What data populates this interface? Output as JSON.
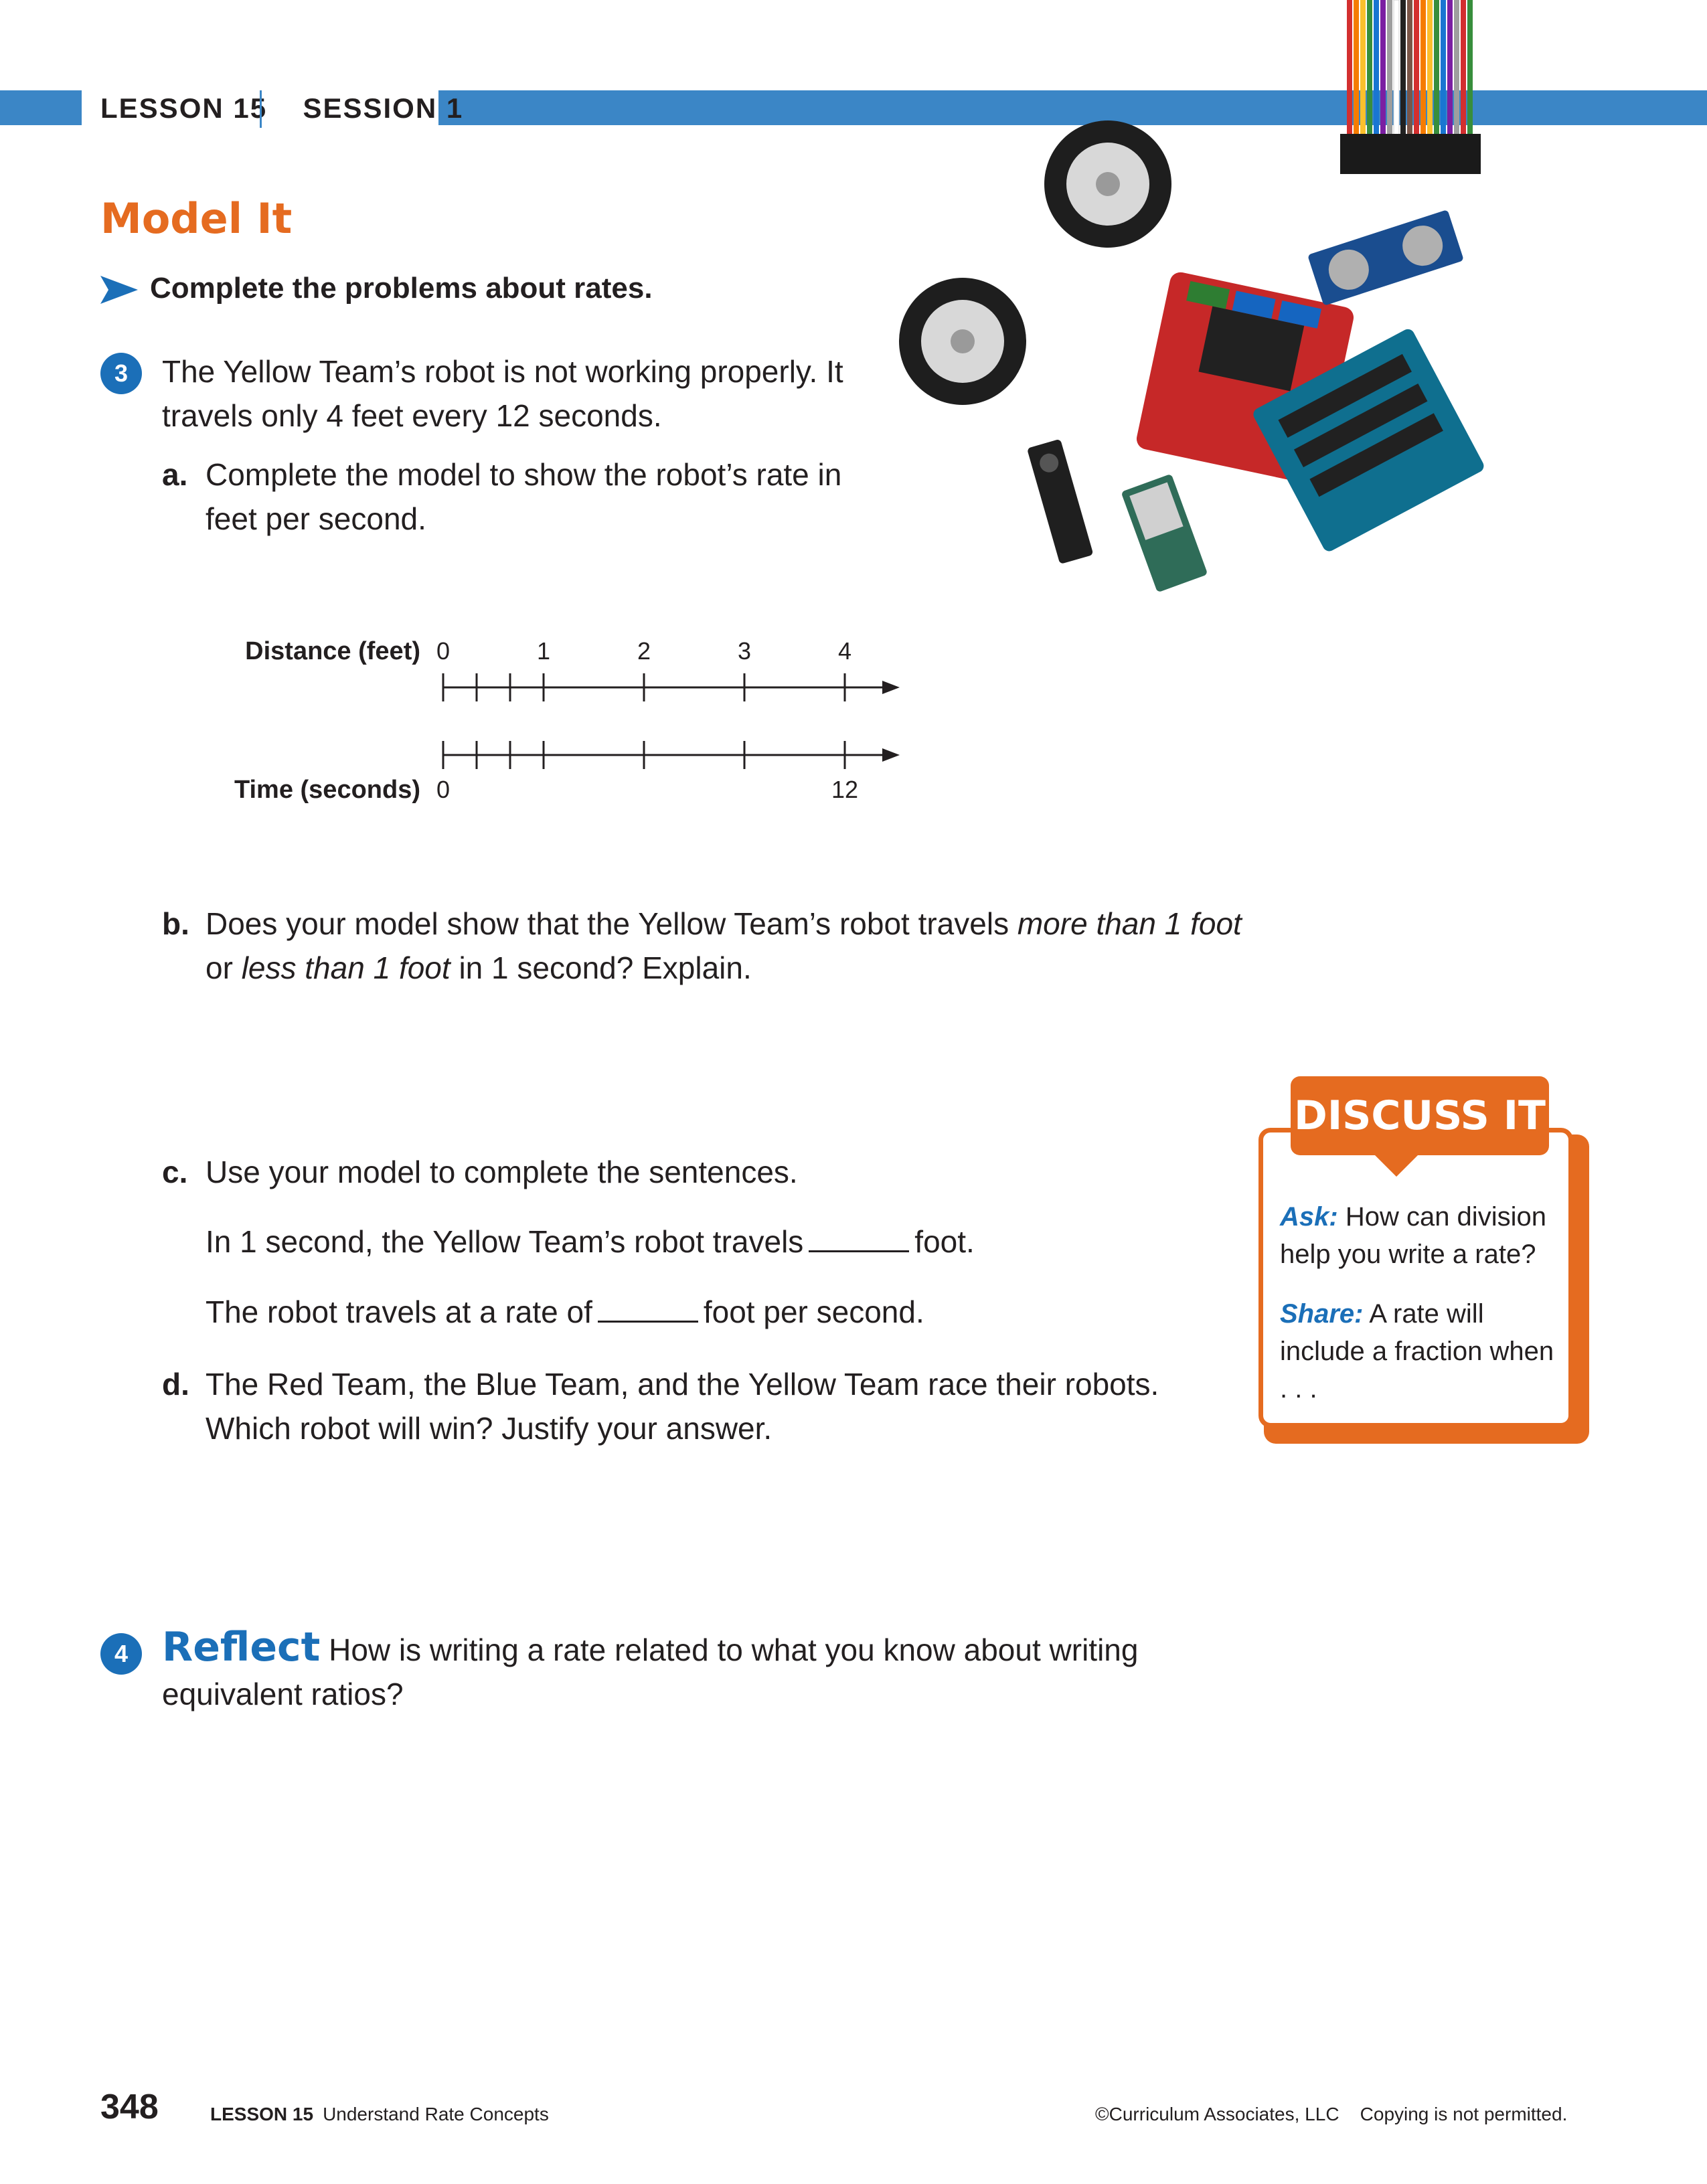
{
  "header": {
    "lesson": "LESSON 15",
    "session": "SESSION 1"
  },
  "section_title": "Model It",
  "instruction": "Complete the problems about rates.",
  "q3": {
    "number": "3",
    "text": "The Yellow Team’s robot is not working properly. It travels only 4 feet every 12 seconds.",
    "a": {
      "letter": "a.",
      "text": "Complete the model to show the robot’s rate in feet per second."
    },
    "b": {
      "letter": "b.",
      "t1": "Does your model show that the Yellow Team’s robot travels ",
      "i1": "more than 1 foot",
      "t2": " or ",
      "i2": "less than 1 foot",
      "t3": " in 1 second? Explain."
    },
    "c": {
      "letter": "c.",
      "text": "Use your model to complete the sentences.",
      "s1_before": "In 1 second, the Yellow Team’s robot travels",
      "s1_after": "foot.",
      "s2_before": "The robot travels at a rate of",
      "s2_after": "foot per second."
    },
    "d": {
      "letter": "d.",
      "text": "The Red Team, the Blue Team, and the Yellow Team race their robots. Which robot will win? Justify your answer."
    }
  },
  "number_lines": {
    "distance_label": "Distance (feet)",
    "distance_ticks": [
      "0",
      "1",
      "2",
      "3",
      "4"
    ],
    "time_label": "Time (seconds)",
    "time_ticks": [
      "0",
      "12"
    ]
  },
  "q4": {
    "number": "4",
    "keyword": "Reflect",
    "text": " How is writing a rate related to what you know about writing equivalent ratios?"
  },
  "discuss": {
    "title": "DISCUSS IT",
    "ask_label": "Ask:",
    "ask_text": " How can division help you write a rate?",
    "share_label": "Share:",
    "share_text": " A rate will include a fraction when . . ."
  },
  "footer": {
    "page_number": "348",
    "lesson_label": "LESSON 15",
    "lesson_title": "Understand Rate Concepts",
    "copyright": "©Curriculum Associates, LLC    Copying is not permitted."
  },
  "colors": {
    "accent_blue": "#3b86c6",
    "number_blue": "#1b6fb8",
    "orange": "#e56b20"
  }
}
